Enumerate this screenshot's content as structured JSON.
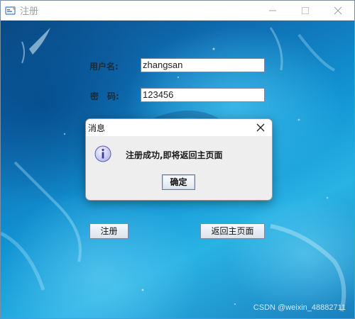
{
  "window": {
    "title": "注册",
    "icon": "java-app-icon",
    "controls": [
      "minimize-icon",
      "maximize-icon",
      "close-icon"
    ]
  },
  "form": {
    "username_label": "用户名:",
    "username_value": "zhangsan",
    "password_label": "密　码:",
    "password_value": "123456",
    "register_button": "注册",
    "back_button": "返回主页面"
  },
  "dialog": {
    "title": "消息",
    "icon": "info-icon",
    "message": "注册成功,即将返回主页面",
    "ok_button": "确定"
  },
  "watermark": "CSDN @weixin_48882711",
  "colors": {
    "background_dark": "#0a4a85",
    "background_light": "#29b2e4",
    "dialog_bg": "#eeeeee",
    "info_icon_fill": "#c8c9f4"
  }
}
